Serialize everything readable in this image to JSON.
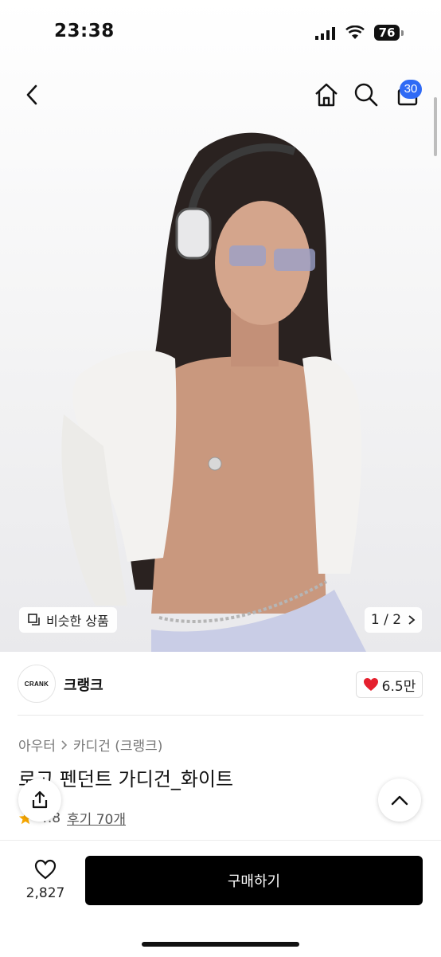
{
  "status_bar": {
    "time": "23:38",
    "battery": "76"
  },
  "nav": {
    "cart_badge": "30"
  },
  "hero": {
    "similar_label": "비슷한 상품",
    "page_indicator": "1 / 2"
  },
  "brand": {
    "logo_text": "CRANK",
    "name": "크랭크",
    "likes": "6.5만"
  },
  "breadcrumbs": [
    "아우터",
    "카디건 (크랭크)"
  ],
  "product": {
    "title": "로고 펜던트 가디건_화이트",
    "rating": "4.8",
    "reviews": "후기 70개"
  },
  "bottom": {
    "wish_count": "2,827",
    "buy_label": "구매하기"
  },
  "colors": {
    "accent_badge": "#2f6af5",
    "heart": "#e5202e",
    "buy_button": "#000000"
  }
}
